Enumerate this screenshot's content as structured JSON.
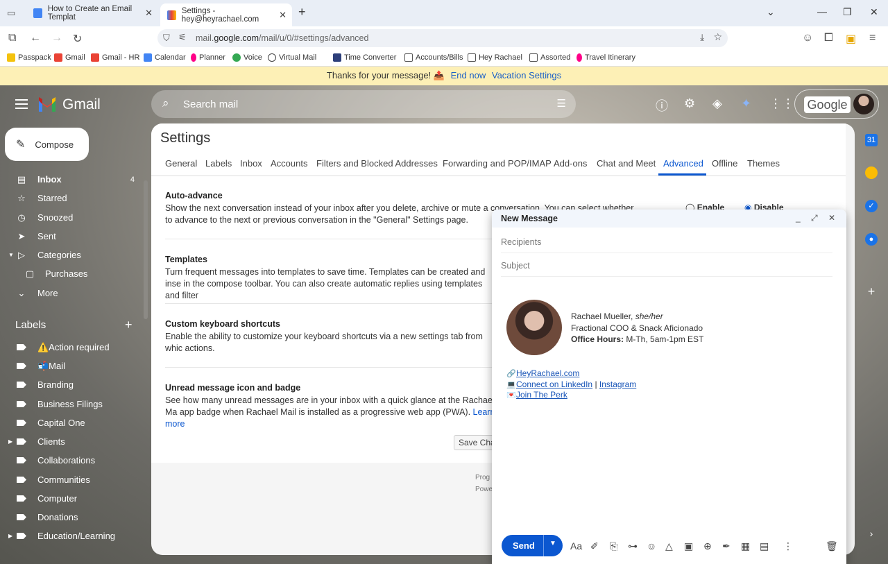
{
  "browser": {
    "tabs": [
      {
        "title": "How to Create an Email Templat"
      },
      {
        "title": "Settings - hey@heyrachael.com"
      }
    ],
    "url_prefix": "mail.",
    "url_domain": "google.com",
    "url_path": "/mail/u/0/#settings/advanced",
    "bookmarks": [
      "Passpack",
      "Gmail",
      "Gmail - HR",
      "Calendar",
      "Planner",
      "Voice",
      "Virtual Mail",
      "Time Converter",
      "Accounts/Bills",
      "Hey Rachael",
      "Assorted",
      "Travel Itinerary"
    ]
  },
  "vacation_bar": {
    "message": "Thanks for your message! 📤",
    "end_now": "End now",
    "settings_link": "Vacation Settings"
  },
  "gmail": {
    "brand": "Gmail",
    "search_placeholder": "Search mail",
    "account_logo": "Google"
  },
  "nav": {
    "compose": "Compose",
    "items": [
      {
        "label": "Inbox",
        "count": "4"
      },
      {
        "label": "Starred"
      },
      {
        "label": "Snoozed"
      },
      {
        "label": "Sent"
      },
      {
        "label": "Categories"
      },
      {
        "label": "Purchases"
      },
      {
        "label": "More"
      }
    ],
    "labels_title": "Labels",
    "labels": [
      "⚠️Action required",
      "📬Mail",
      "Branding",
      "Business Filings",
      "Capital One",
      "Clients",
      "Collaborations",
      "Communities",
      "Computer",
      "Donations",
      "Education/Learning"
    ]
  },
  "settings": {
    "title": "Settings",
    "tabs": [
      "General",
      "Labels",
      "Inbox",
      "Accounts",
      "Filters and Blocked Addresses",
      "Forwarding and POP/IMAP",
      "Add-ons",
      "Chat and Meet",
      "Advanced",
      "Offline",
      "Themes"
    ],
    "active_tab": "Advanced",
    "sections": [
      {
        "title": "Auto-advance",
        "text": "Show the next conversation instead of your inbox after you delete, archive or mute a conversation. You can select whether to advance to the next or previous conversation in the \"General\" Settings page."
      },
      {
        "title": "Templates",
        "text": "Turn frequent messages into templates to save time. Templates can be created and inse in the compose toolbar. You can also create automatic replies using templates and filter"
      },
      {
        "title": "Custom keyboard shortcuts",
        "text": "Enable the ability to customize your keyboard shortcuts via a new settings tab from whic actions."
      },
      {
        "title": "Unread message icon and badge",
        "text": "See how many unread messages are in your inbox with a quick glance at the Rachael Ma app badge when Rachael Mail is installed as a progressive web app (PWA).",
        "link": "Learn more"
      }
    ],
    "radio_enable": "Enable",
    "radio_disable": "Disable",
    "save_button": "Save Cha",
    "footer1": "Prog",
    "footer2": "Power"
  },
  "compose_window": {
    "title": "New Message",
    "recipients_placeholder": "Recipients",
    "subject_placeholder": "Subject",
    "signature": {
      "name": "Rachael Mueller,",
      "pronouns": "she/her",
      "role": "Fractional COO & Snack Aficionado",
      "hours_label": "Office Hours:",
      "hours": "M-Th, 5am-1pm EST",
      "link_site": "HeyRachael.com",
      "link_linkedin": "Connect on LinkedIn",
      "separator": "|",
      "link_instagram": "Instagram",
      "link_perk": "Join The Perk"
    },
    "send_label": "Send"
  }
}
